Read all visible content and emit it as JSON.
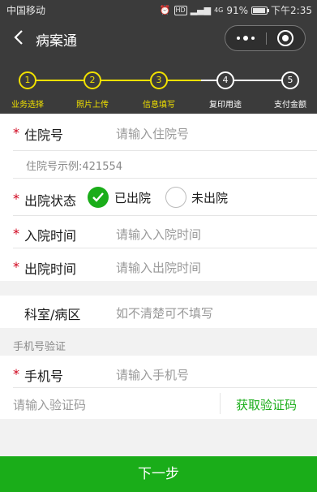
{
  "status_bar": {
    "carrier": "中国移动",
    "hd": "HD",
    "network": "4G",
    "battery_pct": "91%",
    "battery_level": 0.91,
    "time": "下午2:35"
  },
  "nav": {
    "title": "病案通"
  },
  "steps": [
    {
      "num": "1",
      "label": "业务选择",
      "state": "done"
    },
    {
      "num": "2",
      "label": "照片上传",
      "state": "done"
    },
    {
      "num": "3",
      "label": "信息填写",
      "state": "done"
    },
    {
      "num": "4",
      "label": "复印用途",
      "state": "todo"
    },
    {
      "num": "5",
      "label": "支付金额",
      "state": "todo"
    }
  ],
  "colors": {
    "header_bg": "#3b3b3b",
    "step_done": "#f0e000",
    "step_todo": "#ffffff",
    "accent_green": "#1aad19",
    "required": "#d0021b"
  },
  "form": {
    "hospital_no": {
      "required": "*",
      "label": "住院号",
      "placeholder": "请输入住院号",
      "hint": "住院号示例:421554"
    },
    "discharge_status": {
      "required": "*",
      "label": "出院状态",
      "option_yes": "已出院",
      "option_no": "未出院",
      "selected": "已出院"
    },
    "admission_time": {
      "required": "*",
      "label": "入院时间",
      "placeholder": "请输入入院时间"
    },
    "discharge_time": {
      "required": "*",
      "label": "出院时间",
      "placeholder": "请输入出院时间"
    },
    "department": {
      "label": "科室/病区",
      "placeholder": "如不清楚可不填写"
    },
    "phone_section_title": "手机号验证",
    "phone": {
      "required": "*",
      "label": "手机号",
      "placeholder": "请输入手机号"
    },
    "code": {
      "placeholder": "请输入验证码",
      "button": "获取验证码"
    }
  },
  "footer": {
    "next_button": "下一步"
  }
}
